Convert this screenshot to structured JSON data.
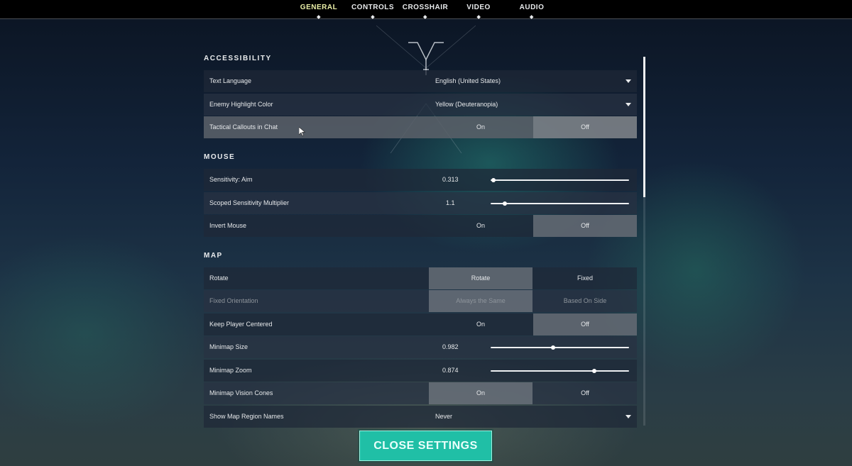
{
  "tabs": [
    {
      "label": "GENERAL",
      "active": true
    },
    {
      "label": "CONTROLS",
      "active": false
    },
    {
      "label": "CROSSHAIR",
      "active": false
    },
    {
      "label": "VIDEO",
      "active": false
    },
    {
      "label": "AUDIO",
      "active": false
    }
  ],
  "sections": {
    "accessibility": "ACCESSIBILITY",
    "mouse": "MOUSE",
    "map": "MAP"
  },
  "accessibility": {
    "text_language": {
      "label": "Text Language",
      "value": "English (United States)"
    },
    "enemy_highlight": {
      "label": "Enemy Highlight Color",
      "value": "Yellow (Deuteranopia)"
    },
    "tactical_callouts": {
      "label": "Tactical Callouts in Chat",
      "on": "On",
      "off": "Off",
      "selected": "Off"
    }
  },
  "mouse": {
    "sensitivity_aim": {
      "label": "Sensitivity: Aim",
      "value": "0.313",
      "fraction": 0.02
    },
    "scoped_multiplier": {
      "label": "Scoped Sensitivity Multiplier",
      "value": "1.1",
      "fraction": 0.1
    },
    "invert_mouse": {
      "label": "Invert Mouse",
      "on": "On",
      "off": "Off",
      "selected": "Off"
    }
  },
  "map": {
    "rotate": {
      "label": "Rotate",
      "option1": "Rotate",
      "option2": "Fixed",
      "selected": "Rotate"
    },
    "fixed_orientation": {
      "label": "Fixed Orientation",
      "option1": "Always the Same",
      "option2": "Based On Side",
      "selected": "Always the Same"
    },
    "keep_player_centered": {
      "label": "Keep Player Centered",
      "on": "On",
      "off": "Off",
      "selected": "Off"
    },
    "minimap_size": {
      "label": "Minimap Size",
      "value": "0.982",
      "fraction": 0.45
    },
    "minimap_zoom": {
      "label": "Minimap Zoom",
      "value": "0.874",
      "fraction": 0.75
    },
    "minimap_vision_cones": {
      "label": "Minimap Vision Cones",
      "on": "On",
      "off": "Off",
      "selected": "On"
    },
    "show_region_names": {
      "label": "Show Map Region Names",
      "value": "Never"
    }
  },
  "close_button": "CLOSE SETTINGS",
  "colors": {
    "accent": "#20bfa6",
    "active_tab": "#ebf0a8",
    "selected_toggle": "#8c9298"
  }
}
